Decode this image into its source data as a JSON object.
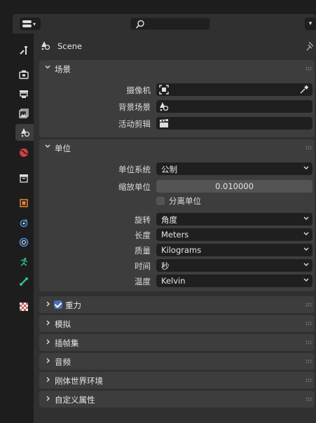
{
  "context": {
    "label": "Scene"
  },
  "sections": {
    "scene": {
      "title": "场景",
      "camera_label": "摄像机",
      "background_label": "背景场景",
      "clip_label": "活动剪辑"
    },
    "units": {
      "title": "单位",
      "unit_system_label": "单位系统",
      "unit_system_value": "公制",
      "unit_scale_label": "缩放单位",
      "unit_scale_value": "0.010000",
      "separate_units_label": "分离单位",
      "rotation_label": "旋转",
      "rotation_value": "角度",
      "length_label": "长度",
      "length_value": "Meters",
      "mass_label": "质量",
      "mass_value": "Kilograms",
      "time_label": "时间",
      "time_value": "秒",
      "temperature_label": "温度",
      "temperature_value": "Kelvin"
    },
    "gravity": {
      "title": "重力",
      "enabled": true
    },
    "simulation": {
      "title": "模拟"
    },
    "keying_sets": {
      "title": "插帧集"
    },
    "audio": {
      "title": "音频"
    },
    "rigid_body_world": {
      "title": "刚体世界环境"
    },
    "custom_properties": {
      "title": "自定义属性"
    }
  },
  "tabs": [
    "tool",
    "render",
    "output",
    "view-layer",
    "scene",
    "world",
    "collection",
    "object",
    "modifiers",
    "particles",
    "physics",
    "constraints",
    "data",
    "texture"
  ],
  "colors": {
    "accent": "#4772b3",
    "panel": "#303030",
    "section": "#3d3d3d",
    "field": "#1f1f1f"
  }
}
